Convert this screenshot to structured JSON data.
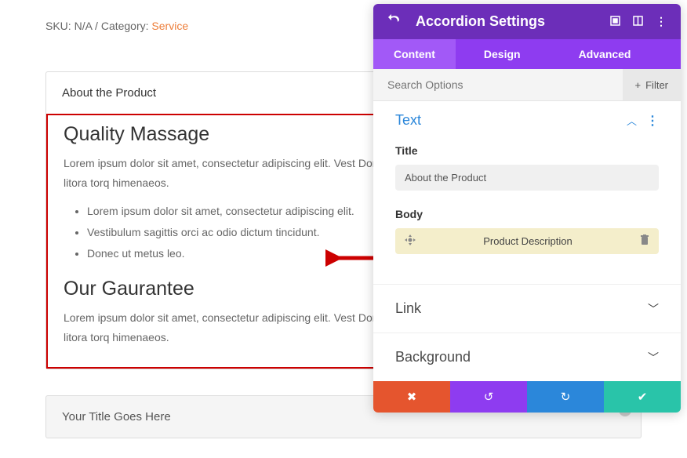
{
  "meta": {
    "sku_prefix": "SKU: ",
    "sku_val": "N/A",
    "sep": " / ",
    "cat_label": "Category: ",
    "service": "Service"
  },
  "accordion1": {
    "title": "About the Product",
    "h1": "Quality Massage",
    "p1": "Lorem ipsum dolor sit amet, consectetur adipiscing elit. Vest Donec ut metus leo. Class aptent taciti sociosqu ad litora torq himenaeos.",
    "bullets": [
      "Lorem ipsum dolor sit amet, consectetur adipiscing elit.",
      "Vestibulum sagittis orci ac odio dictum tincidunt.",
      "Donec ut metus leo."
    ],
    "h2": "Our Gaurantee",
    "p2": "Lorem ipsum dolor sit amet, consectetur adipiscing elit. Vest Donec ut metus leo. Class aptent taciti sociosqu ad litora torq himenaeos."
  },
  "accordion2": {
    "title": "Your Title Goes Here"
  },
  "panel": {
    "title": "Accordion Settings",
    "tabs": {
      "content": "Content",
      "design": "Design",
      "advanced": "Advanced"
    },
    "search_placeholder": "Search Options",
    "filter": "Filter",
    "text_section": "Text",
    "title_label": "Title",
    "title_value": "About the Product",
    "body_label": "Body",
    "body_block": "Product Description",
    "link_section": "Link",
    "bg_section": "Background"
  }
}
